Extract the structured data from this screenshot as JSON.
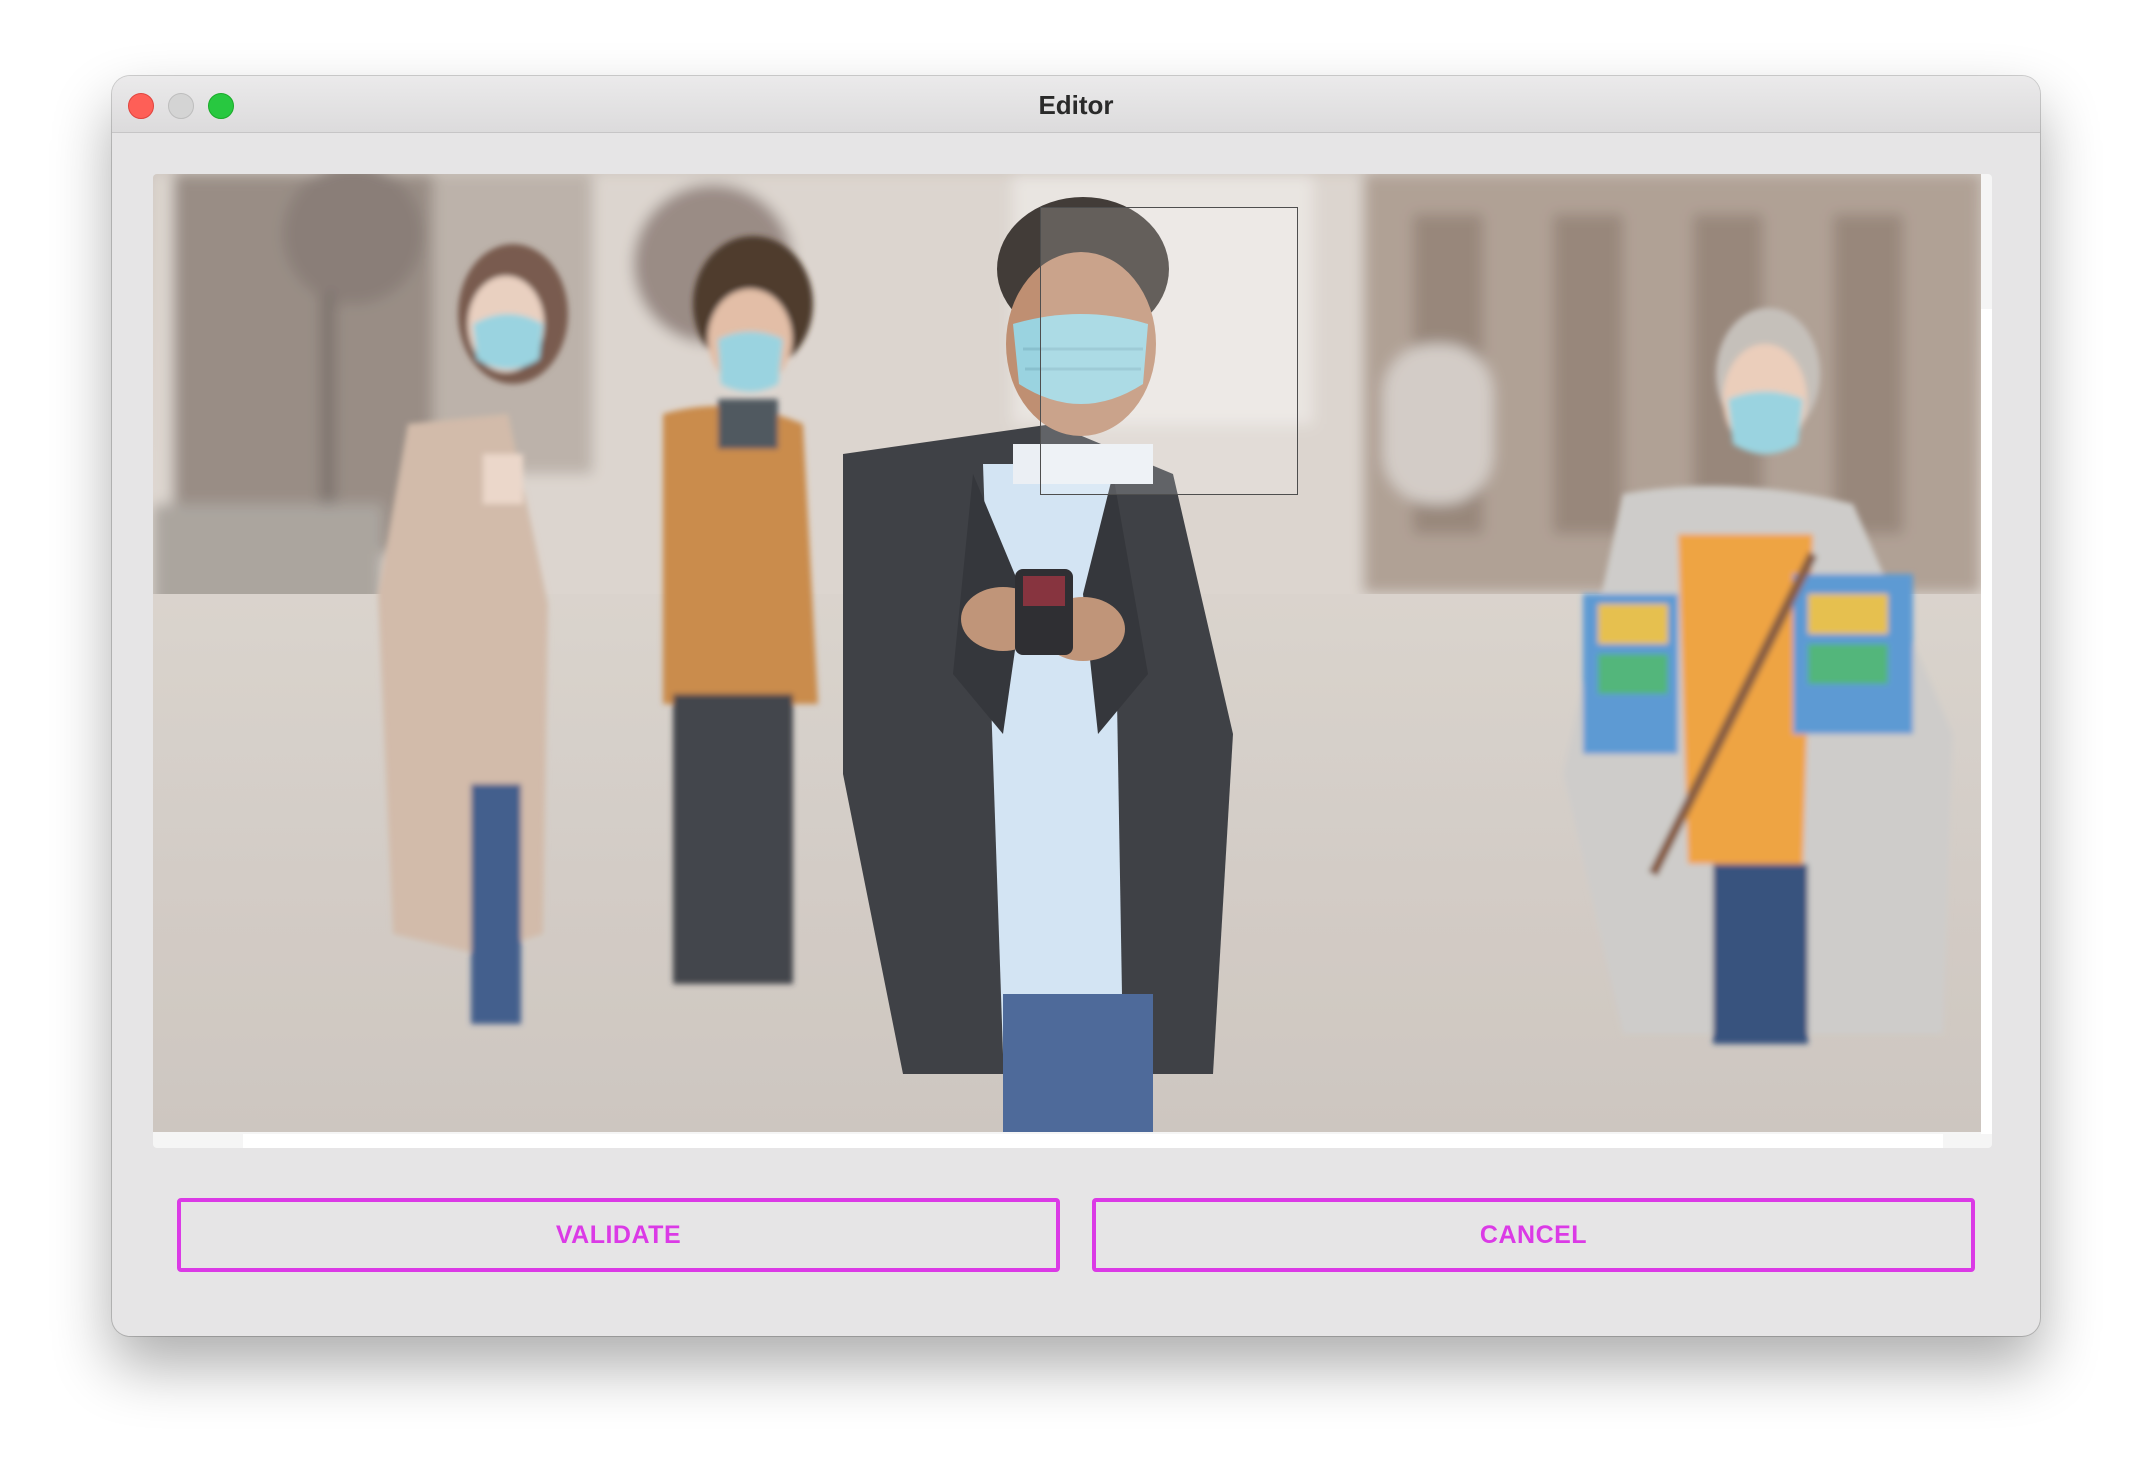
{
  "window": {
    "title": "Editor",
    "controls": [
      "close",
      "minimize",
      "zoom"
    ]
  },
  "editor": {
    "image": "Crowd photo: four people wearing blue surgical face masks walking on a city street; center man in a black leather jacket looking at a smartphone",
    "selection": "face region rectangle"
  },
  "buttons": {
    "validate_label": "VALIDATE",
    "cancel_label": "CANCEL"
  },
  "colors": {
    "accent": "#db3ae6",
    "window_bg": "#e6e5e6",
    "mask_blue": "#8fcfdd"
  },
  "icons": {
    "window_close": "close-traffic-light-icon",
    "window_minimize": "minimize-traffic-light-icon",
    "window_zoom": "zoom-traffic-light-icon"
  }
}
